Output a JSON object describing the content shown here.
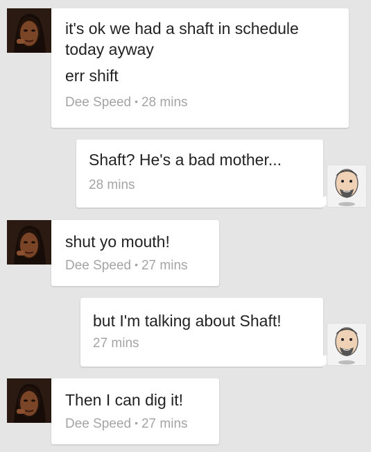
{
  "chat": {
    "messages": [
      {
        "sender": "Dee Speed",
        "lines": [
          "it's ok we had a shaft in schedule today ayway",
          "err shift"
        ],
        "time": "28 mins"
      },
      {
        "lines": [
          "Shaft? He's a bad mother..."
        ],
        "time": "28 mins"
      },
      {
        "sender": "Dee Speed",
        "lines": [
          "shut yo mouth!"
        ],
        "time": "27 mins"
      },
      {
        "lines": [
          "but I'm talking about Shaft!"
        ],
        "time": "27 mins"
      },
      {
        "sender": "Dee Speed",
        "lines": [
          "Then I can dig it!"
        ],
        "time": "27 mins"
      }
    ],
    "separator": "•"
  },
  "colors": {
    "background": "#e5e5e5",
    "bubble": "#ffffff",
    "text": "#222222",
    "meta": "#a4a4a4"
  },
  "icons": {
    "left_avatar": "woman-avatar-icon",
    "right_avatar": "man-caricature-avatar-icon"
  }
}
